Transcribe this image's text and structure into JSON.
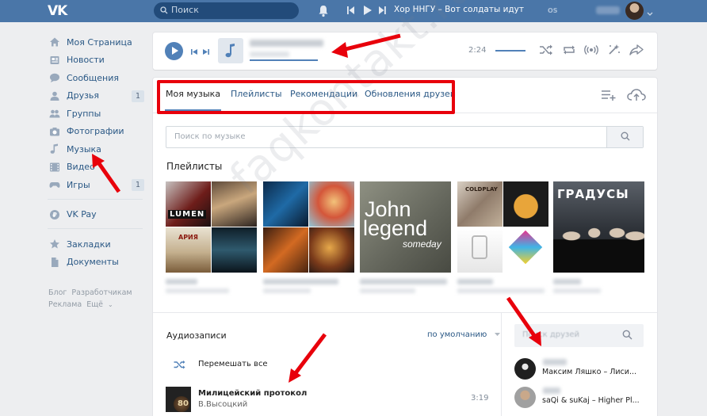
{
  "header": {
    "logo": "VK",
    "search_placeholder": "Поиск",
    "now_playing": "Хор ННГУ – Вот солдаты идут",
    "os_label": "OS"
  },
  "sidebar": {
    "items": [
      {
        "label": "Моя Страница",
        "icon": "home-icon",
        "badge": ""
      },
      {
        "label": "Новости",
        "icon": "news-icon",
        "badge": ""
      },
      {
        "label": "Сообщения",
        "icon": "messages-icon",
        "badge": ""
      },
      {
        "label": "Друзья",
        "icon": "friends-icon",
        "badge": "1"
      },
      {
        "label": "Группы",
        "icon": "groups-icon",
        "badge": ""
      },
      {
        "label": "Фотографии",
        "icon": "camera-icon",
        "badge": ""
      },
      {
        "label": "Музыка",
        "icon": "music-note-icon",
        "badge": ""
      },
      {
        "label": "Видео",
        "icon": "video-icon",
        "badge": ""
      },
      {
        "label": "Игры",
        "icon": "gamepad-icon",
        "badge": "1"
      }
    ],
    "pay": {
      "label": "VK Pay",
      "icon": "vkpay-icon"
    },
    "extra": [
      {
        "label": "Закладки",
        "icon": "star-icon"
      },
      {
        "label": "Документы",
        "icon": "document-icon"
      }
    ],
    "footer": {
      "blog": "Блог",
      "developers": "Разработчикам",
      "ads": "Реклама",
      "more": "Ещё"
    }
  },
  "player": {
    "time": "2:24"
  },
  "tabs": [
    {
      "label": "Моя музыка",
      "active": true
    },
    {
      "label": "Плейлисты",
      "active": false
    },
    {
      "label": "Рекомендации",
      "active": false
    },
    {
      "label": "Обновления друзей",
      "active": false
    }
  ],
  "music_search": {
    "placeholder": "Поиск по музыке"
  },
  "playlists": {
    "title": "Плейлисты",
    "covers": [
      {
        "texts": [
          "LUMEN",
          "АРИЯ"
        ]
      },
      {
        "texts": []
      },
      {
        "texts": [
          "John",
          "legend",
          "someday"
        ]
      },
      {
        "texts": [
          "COLDPLAY"
        ]
      },
      {
        "texts": [
          "ГРАДУСЫ"
        ]
      }
    ]
  },
  "audio": {
    "title": "Аудиозаписи",
    "sort_label": "по умолчанию",
    "shuffle_label": "Перемешать все",
    "tracks": [
      {
        "title": "Милицейский протокол",
        "artist": "В.Высоцкий",
        "duration": "3:19",
        "cover_text": "80"
      }
    ]
  },
  "friends": {
    "search_placeholder": "Поиск друзей",
    "items": [
      {
        "song": "Максим Ляшко – Лиси..."
      },
      {
        "song": "saQi & suKaj – Higher Pl..."
      }
    ]
  },
  "watermark": "faqkontakt.ru",
  "colors": {
    "header": "#4a76a8",
    "link": "#2a5885",
    "accent": "#5181b8",
    "annotation": "#e8000b"
  }
}
